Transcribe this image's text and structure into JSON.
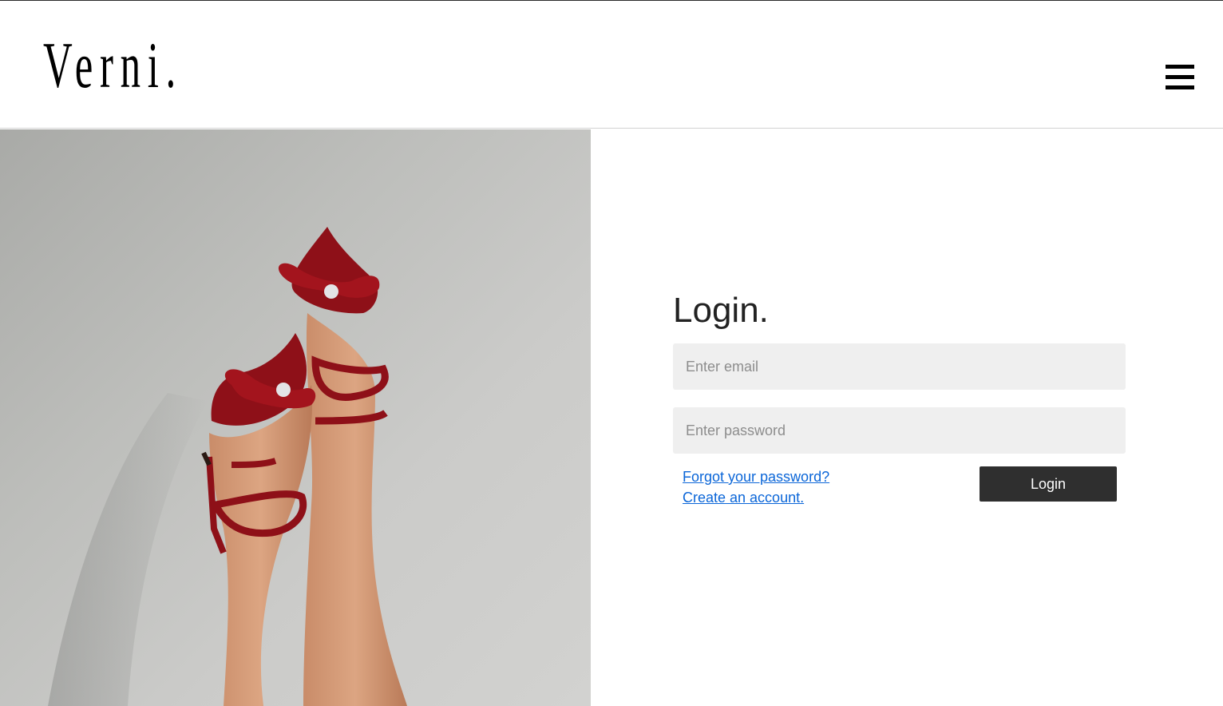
{
  "header": {
    "logo_text": "Verni.",
    "menu_icon": "hamburger-menu-icon"
  },
  "hero": {
    "image_subject": "legs raised against wall wearing red embellished heels"
  },
  "login": {
    "title": "Login.",
    "email_placeholder": "Enter email",
    "email_value": "",
    "password_placeholder": "Enter password",
    "password_value": "",
    "forgot_link": "Forgot your password?",
    "create_link": "Create an account.",
    "submit_label": "Login"
  },
  "colors": {
    "link": "#0b66d8",
    "button_bg": "#2f2f2f",
    "input_bg": "#efefef",
    "shoe_red": "#8e1018"
  }
}
